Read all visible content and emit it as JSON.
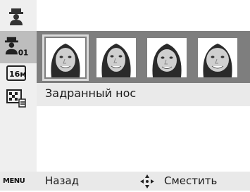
{
  "sidebar": {
    "items": [
      {
        "icon": "face-retouch-icon"
      },
      {
        "icon": "face-retouch-01-icon",
        "badge": "01",
        "selected": true
      },
      {
        "icon": "resolution-16m-icon",
        "badge": "16м"
      },
      {
        "icon": "image-quality-icon"
      }
    ]
  },
  "thumbnails": {
    "items": [
      {
        "icon": "face-thumbnail-icon",
        "selected": true
      },
      {
        "icon": "face-thumbnail-icon",
        "selected": false
      },
      {
        "icon": "face-thumbnail-icon",
        "selected": false
      },
      {
        "icon": "face-thumbnail-icon",
        "selected": false
      }
    ]
  },
  "selection": {
    "label": "Задранный нос"
  },
  "footer": {
    "menu_key": "MENU",
    "back_label": "Назад",
    "move_label": "Сместить"
  },
  "colors": {
    "strip": "#7e7e7e",
    "label_row": "#eaeaea",
    "footer": "#e9e9e9",
    "sidebar": "#efefef"
  }
}
